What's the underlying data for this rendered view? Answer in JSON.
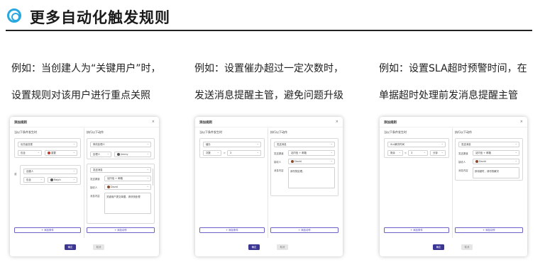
{
  "header": {
    "title": "更多自动化触发规则"
  },
  "examples": [
    {
      "line1": "例如：当创建人为“关键用户”时，",
      "line2": "设置规则对该用户进行重点关照"
    },
    {
      "line1": "例如：设置催办超过一定次数时，",
      "line2": "发送消息提醒主管，避免问题升级"
    },
    {
      "line1": "例如：设置SLA超时预警时间，在",
      "line2": "单据超时处理前发消息提醒主管"
    }
  ],
  "dialog": {
    "title": "添加规则",
    "close": "×",
    "when_label": "当以下条件发生时",
    "then_label": "执行以下动作",
    "add_condition": "+ 添加条件",
    "add_action": "+ 添加动作",
    "confirm": "确定",
    "cancel": "取消"
  },
  "card1": {
    "cond1": {
      "field": "优先级变更",
      "op": "包含",
      "value": "重要"
    },
    "or_label": "或",
    "cond2": {
      "field": "创建人",
      "op": "包含",
      "value": "Ralph"
    },
    "action1": {
      "type": "修改处理人",
      "field": "处理人",
      "value": "Jimmy"
    },
    "action2": {
      "type": "发送消息",
      "channel_label": "发送渠道",
      "channel": "站内信 + 邮箱",
      "recipient_label": "接收人",
      "recipient": "David",
      "content_label": "消息内容",
      "content": "关键用户提交单据，请尽快处理"
    }
  },
  "card2": {
    "cond1": {
      "field": "催办",
      "op": "次数",
      "op2": ">",
      "value": "3"
    },
    "action1": {
      "type": "发送消息",
      "channel_label": "发送渠道",
      "channel": "站内信 + 邮箱",
      "recipient_label": "接收人",
      "recipient": "David",
      "content_label": "消息内容",
      "content": "请尽快处理。"
    }
  },
  "card3": {
    "cond1": {
      "field": "SLA解决时间",
      "op": "剩余",
      "op2": "<",
      "value": "3",
      "unit": "分钟"
    },
    "action1": {
      "type": "发送消息",
      "channel_label": "发送渠道",
      "channel": "站内信 + 邮箱",
      "recipient_label": "接收人",
      "recipient": "David",
      "content_label": "消息内容",
      "content": "即将超时，请尽快解决"
    }
  }
}
